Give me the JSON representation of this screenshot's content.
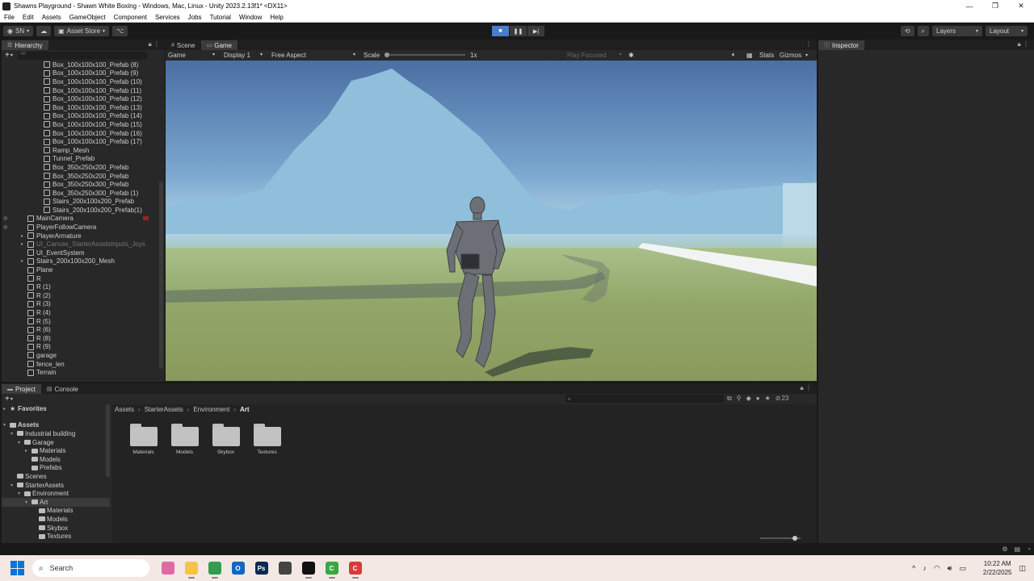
{
  "window": {
    "title": "Shawns Playground - Shawn White Boxing - Windows, Mac, Linux - Unity 2023.2.13f1* <DX11>",
    "controls": [
      "—",
      "❐",
      "✕"
    ]
  },
  "menu": [
    "File",
    "Edit",
    "Assets",
    "GameObject",
    "Component",
    "Services",
    "Jobs",
    "Tutorial",
    "Window",
    "Help"
  ],
  "toolbar": {
    "account": "SN",
    "asset_store": "Asset Store",
    "layers": "Layers",
    "layout": "Layout"
  },
  "hierarchy": {
    "tab": "Hierarchy",
    "search_placeholder": "All",
    "items": [
      {
        "name": "Box_100x100x100_Prefab (8)",
        "indent": 3
      },
      {
        "name": "Box_100x100x100_Prefab (9)",
        "indent": 3
      },
      {
        "name": "Box_100x100x100_Prefab (10)",
        "indent": 3
      },
      {
        "name": "Box_100x100x100_Prefab (11)",
        "indent": 3
      },
      {
        "name": "Box_100x100x100_Prefab (12)",
        "indent": 3
      },
      {
        "name": "Box_100x100x100_Prefab (13)",
        "indent": 3
      },
      {
        "name": "Box_100x100x100_Prefab (14)",
        "indent": 3
      },
      {
        "name": "Box_100x100x100_Prefab (15)",
        "indent": 3
      },
      {
        "name": "Box_100x100x100_Prefab (16)",
        "indent": 3
      },
      {
        "name": "Box_100x100x100_Prefab (17)",
        "indent": 3
      },
      {
        "name": "Ramp_Mesh",
        "indent": 3
      },
      {
        "name": "Tunnel_Prefab",
        "indent": 3
      },
      {
        "name": "Box_350x250x200_Prefab",
        "indent": 3
      },
      {
        "name": "Box_350x250x200_Prefab",
        "indent": 3
      },
      {
        "name": "Box_350x250x300_Prefab",
        "indent": 3
      },
      {
        "name": "Box_350x250x300_Prefab (1)",
        "indent": 3
      },
      {
        "name": "Stairs_200x100x200_Prefab",
        "indent": 3
      },
      {
        "name": "Stairs_200x100x200_Prefab(1)",
        "indent": 3
      },
      {
        "name": "MainCamera",
        "indent": 1,
        "eye": true,
        "rec": true
      },
      {
        "name": "PlayerFollowCamera",
        "indent": 1,
        "eye": true
      },
      {
        "name": "PlayerArmature",
        "indent": 1,
        "fold": true
      },
      {
        "name": "UI_Canvas_StarterAssetsInputs_Joys",
        "indent": 1,
        "fold": true,
        "disabled": true
      },
      {
        "name": "UI_EventSystem",
        "indent": 1
      },
      {
        "name": "Stairs_200x100x200_Mesh",
        "indent": 1,
        "fold": true
      },
      {
        "name": "Plane",
        "indent": 1
      },
      {
        "name": "R",
        "indent": 1
      },
      {
        "name": "R (1)",
        "indent": 1
      },
      {
        "name": "R (2)",
        "indent": 1
      },
      {
        "name": "R (3)",
        "indent": 1
      },
      {
        "name": "R (4)",
        "indent": 1
      },
      {
        "name": "R (5)",
        "indent": 1
      },
      {
        "name": "R (6)",
        "indent": 1
      },
      {
        "name": "R (8)",
        "indent": 1
      },
      {
        "name": "R (9)",
        "indent": 1
      },
      {
        "name": "garage",
        "indent": 1
      },
      {
        "name": "fence_len",
        "indent": 1
      },
      {
        "name": "Terrain",
        "indent": 1
      }
    ]
  },
  "game_view": {
    "tabs": [
      "Scene",
      "Game"
    ],
    "mode": "Game",
    "display": "Display 1",
    "aspect": "Free Aspect",
    "scale_label": "Scale",
    "scale_value": "1x",
    "play_focused": "Play Focused",
    "stats": "Stats",
    "gizmos": "Gizmos"
  },
  "inspector": {
    "tab": "Inspector"
  },
  "project": {
    "tabs": [
      "Project",
      "Console"
    ],
    "badge_count": "23",
    "tree": [
      {
        "name": "Favorites",
        "indent": 0,
        "fold": "▸",
        "bold": true,
        "star": true
      },
      {
        "name": "Assets",
        "indent": 0,
        "fold": "▾",
        "bold": true
      },
      {
        "name": "Industrial building",
        "indent": 1,
        "fold": "▾"
      },
      {
        "name": "Garage",
        "indent": 2,
        "fold": "▾"
      },
      {
        "name": "Materials",
        "indent": 3,
        "fold": "▸"
      },
      {
        "name": "Models",
        "indent": 3,
        "fold": ""
      },
      {
        "name": "Prefabs",
        "indent": 3,
        "fold": ""
      },
      {
        "name": "Scenes",
        "indent": 1,
        "fold": ""
      },
      {
        "name": "StarterAssets",
        "indent": 1,
        "fold": "▾"
      },
      {
        "name": "Environment",
        "indent": 2,
        "fold": "▾"
      },
      {
        "name": "Art",
        "indent": 3,
        "fold": "▾",
        "selected": true
      },
      {
        "name": "Materials",
        "indent": 4,
        "fold": ""
      },
      {
        "name": "Models",
        "indent": 4,
        "fold": ""
      },
      {
        "name": "Skybox",
        "indent": 4,
        "fold": ""
      },
      {
        "name": "Textures",
        "indent": 4,
        "fold": ""
      }
    ],
    "breadcrumb": [
      "Assets",
      "StarterAssets",
      "Environment",
      "Art"
    ],
    "folders": [
      "Materials",
      "Models",
      "Skybox",
      "Textures"
    ]
  },
  "taskbar": {
    "search": "Search",
    "time": "10:22 AM",
    "date": "2/22/2025",
    "apps": [
      {
        "name": "widgets-icon",
        "color": "#e06aa6",
        "label": "",
        "running": false
      },
      {
        "name": "file-explorer-icon",
        "color": "#f2c44b",
        "label": "",
        "running": true
      },
      {
        "name": "chrome-icon",
        "color": "#2f9e4e",
        "label": "",
        "running": true
      },
      {
        "name": "outlook-icon",
        "color": "#1166c2",
        "label": "O",
        "running": false
      },
      {
        "name": "photoshop-icon",
        "color": "#0b2a4d",
        "label": "Ps",
        "running": false
      },
      {
        "name": "unity-hub-icon",
        "color": "#444444",
        "label": "",
        "running": false
      },
      {
        "name": "unity-icon",
        "color": "#111111",
        "label": "",
        "running": true
      },
      {
        "name": "camtasia-icon",
        "color": "#3aa840",
        "label": "C",
        "running": true
      },
      {
        "name": "camtasia-recorder-icon",
        "color": "#d93a3a",
        "label": "C",
        "running": true
      }
    ]
  }
}
